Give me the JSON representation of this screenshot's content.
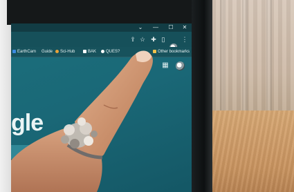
{
  "window": {
    "minimize": "—",
    "maximize": "☐",
    "close": "✕",
    "dropdown": "⌄"
  },
  "toolbar": {
    "share_icon": "⇪",
    "star_icon": "☆",
    "extensions_icon": "✚",
    "sidepanel_icon": "▯",
    "menu_icon": "⋮"
  },
  "bookmarks": [
    {
      "icon": "earthcam",
      "label": "EarthCam"
    },
    {
      "icon": "folder",
      "label": "Guide"
    },
    {
      "icon": "scihub",
      "label": "Sci-Hub"
    },
    {
      "icon": "bookmark",
      "label": "BAK"
    },
    {
      "icon": "search",
      "label": "QUES?"
    }
  ],
  "other_bookmarks": "Other bookmarks",
  "page": {
    "logo_fragment": "gle",
    "apps_icon": "⋮⋮⋮"
  },
  "colors": {
    "screen": "#1a6877",
    "toolbar": "#16505a",
    "title_bar": "#123c44"
  }
}
